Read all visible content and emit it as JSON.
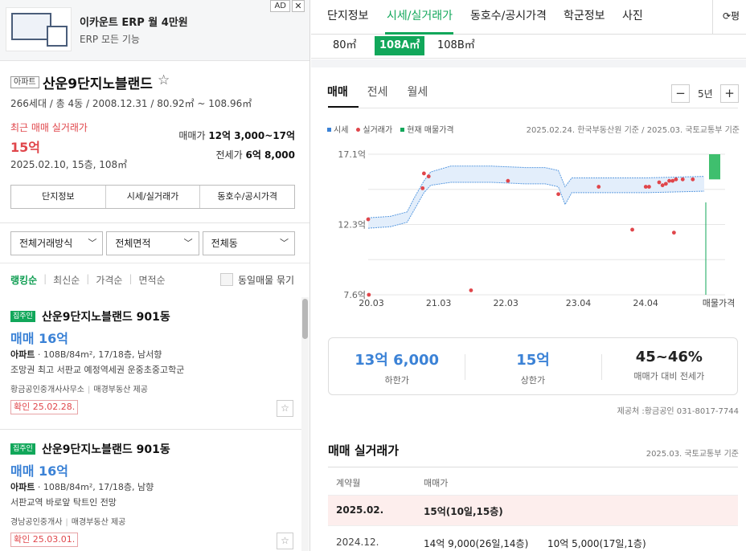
{
  "ad": {
    "title": "이카운트 ERP 월 4만원",
    "subtitle": "ERP 모든 기능",
    "badge": "AD",
    "close": "✕"
  },
  "complex": {
    "type": "아파트",
    "name": "산운9단지노블랜드",
    "meta": "266세대 / 총 4동 / 2008.12.31 / 80.92㎡ ~ 108.96㎡",
    "recent_label": "최근 매매 실거래가",
    "recent_price": "15억",
    "recent_date": "2025.02.10, 15층, 108㎡",
    "sale_label": "매매가",
    "sale_range": "12억 3,000~17억",
    "jeonse_label": "전세가",
    "jeonse_range": "6억 8,000",
    "tabs": [
      "단지정보",
      "시세/실거래가",
      "동호수/공시가격"
    ]
  },
  "filters": [
    "전체거래방식",
    "전체면적",
    "전체동"
  ],
  "sort": {
    "items": [
      "랭킹순",
      "최신순",
      "가격순",
      "면적순"
    ],
    "same_label": "동일매물 묶기"
  },
  "listings": [
    {
      "badge": "집주인",
      "title": "산운9단지노블랜드 901동",
      "price": "매매 16억",
      "spec_type": "아파트",
      "spec": " · 108B/84m², 17/18층, 남서향",
      "desc": "조망권 최고 서판교 예정역세권 운중초중고학군",
      "agent": "황금공인중개사사무소",
      "provider": "매경부동산 제공",
      "confirm": "확인 25.02.28."
    },
    {
      "badge": "집주인",
      "title": "산운9단지노블랜드 901동",
      "price": "매매 16억",
      "spec_type": "아파트",
      "spec": " · 108B/84m², 17/18층, 남향",
      "desc": "서판교역 바로앞 탁트인 전망",
      "agent": "경남공인중개사",
      "provider": "매경부동산 제공",
      "confirm": "확인 25.03.01."
    }
  ],
  "topnav": {
    "items": [
      "단지정보",
      "시세/실거래가",
      "동호수/공시가격",
      "학군정보",
      "사진"
    ],
    "right": "⟳평"
  },
  "sizes": [
    "80㎡",
    "108A㎡",
    "108B㎡"
  ],
  "price_tabs": [
    "매매",
    "전세",
    "월세"
  ],
  "period": "5년",
  "legend": {
    "items": [
      "시세",
      "실거래가",
      "현재 매물가격"
    ],
    "note": "2025.02.24. 한국부동산원 기준 / 2025.03. 국토교통부 기준"
  },
  "colors": {
    "accent": "#11a75a",
    "price_blue": "#3b82d6",
    "deal_red": "#e0464b",
    "band": "#e3eefb"
  },
  "chart_data": {
    "type": "line",
    "x_ticks": [
      "20.03",
      "21.03",
      "22.03",
      "23.04",
      "24.04"
    ],
    "y_ticks": [
      "17.1억",
      "12.3억",
      "7.6억"
    ],
    "ylim": [
      7.6,
      17.1
    ],
    "xlim": [
      2020.17,
      2025.17
    ],
    "extra_xlabel": "매물가격",
    "series": [
      {
        "name": "시세",
        "band_upper": [
          [
            2020.17,
            12.8
          ],
          [
            2020.5,
            12.9
          ],
          [
            2020.75,
            13.2
          ],
          [
            2020.85,
            14.1
          ],
          [
            2021.0,
            15.3
          ],
          [
            2021.1,
            15.9
          ],
          [
            2021.4,
            16.3
          ],
          [
            2022.0,
            16.3
          ],
          [
            2022.5,
            16.2
          ],
          [
            2022.8,
            16.2
          ],
          [
            2023.0,
            16.0
          ],
          [
            2023.1,
            14.9
          ],
          [
            2023.2,
            15.5
          ],
          [
            2023.8,
            15.5
          ],
          [
            2024.3,
            15.5
          ],
          [
            2025.17,
            15.6
          ]
        ],
        "band_lower": [
          [
            2020.17,
            12.1
          ],
          [
            2020.5,
            12.2
          ],
          [
            2020.75,
            12.5
          ],
          [
            2020.85,
            13.3
          ],
          [
            2021.0,
            14.5
          ],
          [
            2021.1,
            15.0
          ],
          [
            2021.4,
            15.2
          ],
          [
            2022.0,
            15.2
          ],
          [
            2022.5,
            15.1
          ],
          [
            2022.8,
            15.1
          ],
          [
            2023.0,
            14.9
          ],
          [
            2023.1,
            13.7
          ],
          [
            2023.2,
            14.5
          ],
          [
            2023.8,
            14.5
          ],
          [
            2024.3,
            14.5
          ],
          [
            2025.17,
            14.6
          ]
        ]
      },
      {
        "name": "실거래가",
        "points": [
          [
            2020.17,
            12.7
          ],
          [
            2020.18,
            7.6
          ],
          [
            2020.98,
            14.8
          ],
          [
            2021.0,
            15.8
          ],
          [
            2021.07,
            15.6
          ],
          [
            2021.7,
            7.9
          ],
          [
            2022.25,
            15.3
          ],
          [
            2023.0,
            14.4
          ],
          [
            2023.6,
            14.9
          ],
          [
            2024.1,
            12.0
          ],
          [
            2024.3,
            14.9
          ],
          [
            2024.35,
            14.9
          ],
          [
            2024.5,
            15.2
          ],
          [
            2024.55,
            15.0
          ],
          [
            2024.6,
            15.1
          ],
          [
            2024.65,
            15.3
          ],
          [
            2024.7,
            15.3
          ],
          [
            2024.72,
            11.8
          ],
          [
            2024.75,
            15.4
          ],
          [
            2024.85,
            15.4
          ],
          [
            2025.0,
            15.4
          ]
        ]
      },
      {
        "name": "현재 매물가격",
        "range": [
          15.4,
          17.1
        ]
      }
    ]
  },
  "stats": [
    {
      "value": "13억 6,000",
      "label": "하한가"
    },
    {
      "value": "15억",
      "label": "상한가"
    },
    {
      "value": "45~46%",
      "label": "매매가 대비 전세가"
    }
  ],
  "provider_note": "제공처 :황금공인 031-8017-7744",
  "transactions": {
    "title": "매매 실거래가",
    "note": "2025.03. 국토교통부 기준",
    "headers": [
      "계약월",
      "매매가"
    ],
    "rows": [
      {
        "month": "2025.02.",
        "price": "15억(10일,15층)",
        "price2": ""
      },
      {
        "month": "2024.12.",
        "price": "14억 9,000(26일,14층)",
        "price2": "10억 5,000(17일,1층)"
      }
    ]
  }
}
